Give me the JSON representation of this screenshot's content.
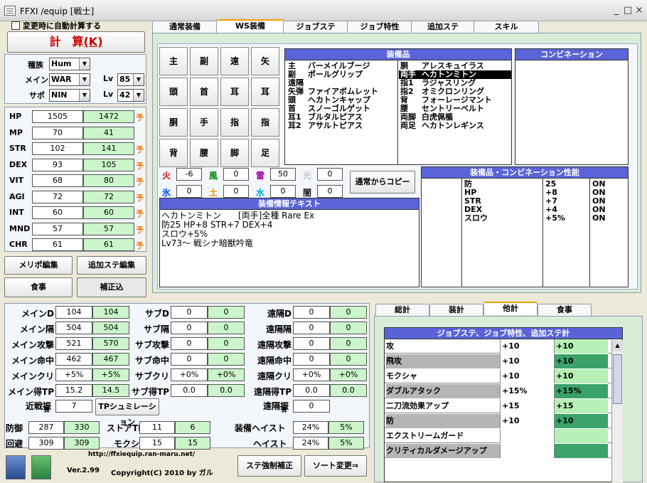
{
  "window": {
    "title": "FFXI /equip [戦士]",
    "controls": [
      "_",
      "□",
      "×"
    ]
  },
  "auto_calc": "変更時に自動計算する",
  "calc_button": "計　算",
  "calc_key": "(K)",
  "selectors": {
    "race_label": "種族",
    "race": "Hum",
    "main_label": "メイン",
    "main": "WAR",
    "sub_label": "サポ",
    "sub": "NIN",
    "lv_label": "Lv",
    "main_lv": "85",
    "sub_lv": "42"
  },
  "stats": [
    {
      "name": "HP",
      "base": "1505",
      "total": "1472",
      "mark": "予"
    },
    {
      "name": "MP",
      "base": "70",
      "total": "41",
      "mark": ""
    },
    {
      "name": "STR",
      "base": "102",
      "total": "141",
      "mark": "予"
    },
    {
      "name": "DEX",
      "base": "93",
      "total": "105",
      "mark": "予"
    },
    {
      "name": "VIT",
      "base": "68",
      "total": "80",
      "mark": "予"
    },
    {
      "name": "AGI",
      "base": "72",
      "total": "72",
      "mark": "予"
    },
    {
      "name": "INT",
      "base": "60",
      "total": "60",
      "mark": "予"
    },
    {
      "name": "MND",
      "base": "57",
      "total": "57",
      "mark": "予"
    },
    {
      "name": "CHR",
      "base": "61",
      "total": "61",
      "mark": "予"
    }
  ],
  "left_buttons": {
    "merit": "メリポ編集",
    "extra": "追加ステ編集",
    "meal": "食事",
    "correction": "補正込"
  },
  "tabs": [
    "通常装備",
    "WS装備",
    "ジョブステ",
    "ジョブ特性",
    "追加ステ",
    "スキル"
  ],
  "slots": [
    "主",
    "副",
    "遠",
    "矢",
    "頭",
    "首",
    "耳",
    "耳",
    "胴",
    "手",
    "指",
    "指",
    "背",
    "腰",
    "脚",
    "足"
  ],
  "equip_header": "装備品",
  "equip_left": [
    [
      "主",
      "バーメイルブージ"
    ],
    [
      "副",
      "ポールグリップ"
    ],
    [
      "遠隔",
      ""
    ],
    [
      "矢弾",
      "ファイアボムレット"
    ],
    [
      "頭",
      "ヘカトンキャップ"
    ],
    [
      "首",
      "スノーゴルゲット"
    ],
    [
      "耳1",
      "ブルタルピアス"
    ],
    [
      "耳2",
      "アサルトピアス"
    ]
  ],
  "equip_right": [
    [
      "胴",
      "アレスキュイラス"
    ],
    [
      "両手",
      "ヘカトンミトン"
    ],
    [
      "指1",
      "ラジャスリング"
    ],
    [
      "指2",
      "オミクロンリング"
    ],
    [
      "背",
      "フォーレージマント"
    ],
    [
      "腰",
      "セントリーベルト"
    ],
    [
      "両脚",
      "白虎佩楯"
    ],
    [
      "両足",
      "ヘカトンレギンス"
    ]
  ],
  "combo_header": "コンビネーション",
  "elements": [
    {
      "name": "火",
      "value": "-6",
      "color": "#e00000"
    },
    {
      "name": "風",
      "value": "0",
      "color": "#008000"
    },
    {
      "name": "雷",
      "value": "50",
      "color": "#a000a0"
    },
    {
      "name": "光",
      "value": "0",
      "color": "#c8c8c8"
    },
    {
      "name": "氷",
      "value": "0",
      "color": "#0050e0"
    },
    {
      "name": "土",
      "value": "0",
      "color": "#e0a000"
    },
    {
      "name": "水",
      "value": "0",
      "color": "#00a0e0"
    },
    {
      "name": "闇",
      "value": "0",
      "color": "#202020"
    }
  ],
  "copy_button": "通常からコピー",
  "info_header": "装備情報テキスト",
  "info_text": [
    "ヘカトンミトン　　[両手]全種 Rare Ex",
    "防25 HP+8 STR+7 DEX+4",
    "スロウ+5%",
    "Lv73～ 戦シナ暗獣吟竜"
  ],
  "perf_header": "装備品・コンビネーション性能",
  "perf": [
    [
      "防",
      "25",
      "ON"
    ],
    [
      "HP",
      "+8",
      "ON"
    ],
    [
      "STR",
      "+7",
      "ON"
    ],
    [
      "DEX",
      "+4",
      "ON"
    ],
    [
      "スロウ",
      "+5%",
      "ON"
    ]
  ],
  "bottom_stats": {
    "main_d": {
      "label": "メインD",
      "a": "104",
      "b": "104"
    },
    "main_int": {
      "label": "メイン隔",
      "a": "504",
      "b": "504"
    },
    "main_atk": {
      "label": "メイン攻撃",
      "a": "521",
      "b": "570"
    },
    "main_acc": {
      "label": "メイン命中",
      "a": "462",
      "b": "467"
    },
    "main_crit": {
      "label": "メインクリ",
      "a": "+5%",
      "b": "+5%"
    },
    "main_tp": {
      "label": "メイン得TP",
      "a": "15.2",
      "b": "14.5"
    },
    "sub_d": {
      "label": "サブD",
      "a": "0",
      "b": "0"
    },
    "sub_int": {
      "label": "サブ隔",
      "a": "0",
      "b": "0"
    },
    "sub_atk": {
      "label": "サブ攻撃",
      "a": "0",
      "b": "0"
    },
    "sub_acc": {
      "label": "サブ命中",
      "a": "0",
      "b": "0"
    },
    "sub_crit": {
      "label": "サブクリ",
      "a": "+0%",
      "b": "+0%"
    },
    "sub_tp": {
      "label": "サブ得TP",
      "a": "0.0",
      "b": "0.0"
    },
    "r_d": {
      "label": "遠隔D",
      "a": "0",
      "b": "0"
    },
    "r_int": {
      "label": "遠隔隔",
      "a": "0",
      "b": "0"
    },
    "r_atk": {
      "label": "遠隔攻撃",
      "a": "0",
      "b": "0"
    },
    "r_acc": {
      "label": "遠隔命中",
      "a": "0",
      "b": "0"
    },
    "r_crit": {
      "label": "遠隔クリ",
      "a": "+0%",
      "b": "+0%"
    },
    "r_tp": {
      "label": "遠隔得TP",
      "a": "0.0",
      "b": "0.0"
    }
  },
  "melee_skill": {
    "label": "近戦振",
    "sub": "算",
    "value": "7"
  },
  "ranged_skill": {
    "label": "遠隔振",
    "sub": "算",
    "value": "0"
  },
  "tp_sim": "TPシュミレーション",
  "defense": {
    "label": "防御",
    "a": "287",
    "b": "330"
  },
  "evasion": {
    "label": "回避",
    "a": "309",
    "b": "309"
  },
  "store_tp": {
    "label": "ストアTP",
    "a": "11",
    "b": "6"
  },
  "mokusha": {
    "label": "モクシャ",
    "a": "15",
    "b": "15"
  },
  "equip_haste": {
    "label": "装備ヘイスト",
    "a": "24%",
    "b": "5%"
  },
  "haste": {
    "label": "ヘイスト",
    "a": "24%",
    "b": "5%"
  },
  "url": "http://ffxiequip.ran-maru.net/",
  "version": "Ver.2.99",
  "copyright": "Copyright(C) 2010 by ガル",
  "force_button": "ステ強制補正",
  "sort_button": "ソート変更⇒",
  "right_tabs": [
    "総計",
    "装計",
    "他計",
    "食事"
  ],
  "job_header": "ジョブステ、ジョブ特性、追加ステ計",
  "job_rows": [
    {
      "name": "攻",
      "v1": "+10",
      "v2": "+10",
      "g": false
    },
    {
      "name": "飛攻",
      "v1": "+10",
      "v2": "+10",
      "g": true
    },
    {
      "name": "モクシャ",
      "v1": "+10",
      "v2": "+10",
      "g": false
    },
    {
      "name": "ダブルアタック",
      "v1": "+15%",
      "v2": "+15%",
      "g": true
    },
    {
      "name": "二刀流効果アップ",
      "v1": "+15",
      "v2": "+15",
      "g": false
    },
    {
      "name": "防",
      "v1": "+10",
      "v2": "+10",
      "g": true
    },
    {
      "name": "エクストリームガード",
      "v1": "",
      "v2": "",
      "g": false
    },
    {
      "name": "クリティカルダメージアップ",
      "v1": "",
      "v2": "",
      "g": true
    }
  ]
}
